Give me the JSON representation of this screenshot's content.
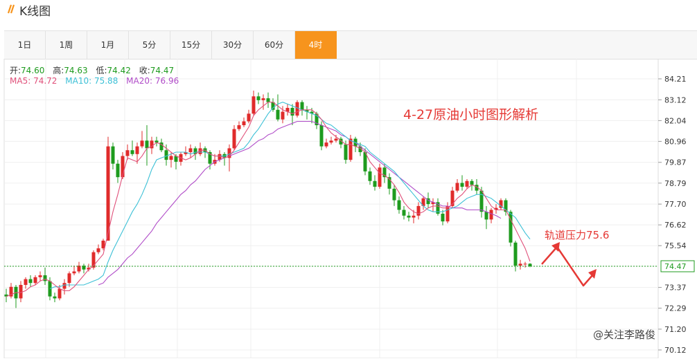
{
  "header": {
    "title": "K线图",
    "icon": "double-slash-icon"
  },
  "tabs": [
    {
      "label": "1日",
      "active": false
    },
    {
      "label": "1周",
      "active": false
    },
    {
      "label": "1月",
      "active": false
    },
    {
      "label": "5分",
      "active": false
    },
    {
      "label": "15分",
      "active": false
    },
    {
      "label": "30分",
      "active": false
    },
    {
      "label": "60分",
      "active": false
    },
    {
      "label": "4时",
      "active": true
    }
  ],
  "info": {
    "open_label": "开:",
    "open": "74.60",
    "high_label": "高:",
    "high": "74.63",
    "low_label": "低:",
    "low": "74.42",
    "close_label": "收:",
    "close": "74.47",
    "ma5_label": "MA5:",
    "ma5": "74.72",
    "ma10_label": "MA10:",
    "ma10": "75.88",
    "ma20_label": "MA20:",
    "ma20": "76.96"
  },
  "annotation": {
    "title": "4-27原油小时图形解析",
    "resistance": "轨道压力75.6"
  },
  "watermark": "@关注李路俊",
  "colors": {
    "up": "#e02b2b",
    "down": "#1e9b1e",
    "ma5": "#e0507a",
    "ma10": "#3cc0d6",
    "ma20": "#b04cc8",
    "accent": "#f7941d",
    "annotation": "#e53935"
  },
  "chart_data": {
    "type": "candlestick",
    "ylim": [
      70.12,
      84.21
    ],
    "yticks": [
      "84.21",
      "83.12",
      "82.04",
      "80.96",
      "79.87",
      "78.79",
      "77.70",
      "76.62",
      "75.54",
      "74.47",
      "73.37",
      "72.29",
      "71.20",
      "70.12"
    ],
    "last_price": "74.47",
    "candles": [
      [
        73.0,
        72.9,
        73.3,
        72.6
      ],
      [
        72.9,
        73.4,
        73.6,
        72.8
      ],
      [
        73.4,
        72.8,
        73.5,
        72.3
      ],
      [
        72.8,
        73.5,
        73.7,
        72.6
      ],
      [
        73.5,
        73.8,
        73.9,
        73.3
      ],
      [
        73.8,
        73.6,
        74.0,
        73.4
      ],
      [
        73.6,
        73.9,
        74.0,
        73.5
      ],
      [
        73.9,
        74.0,
        74.2,
        73.7
      ],
      [
        74.0,
        73.7,
        74.4,
        73.5
      ],
      [
        73.7,
        72.9,
        73.9,
        72.7
      ],
      [
        72.9,
        72.8,
        73.1,
        72.6
      ],
      [
        72.8,
        73.3,
        73.5,
        72.7
      ],
      [
        73.3,
        73.6,
        73.8,
        73.0
      ],
      [
        73.6,
        74.1,
        74.2,
        73.4
      ],
      [
        74.1,
        74.2,
        74.5,
        74.0
      ],
      [
        74.2,
        74.5,
        74.7,
        74.1
      ],
      [
        74.5,
        74.3,
        74.6,
        74.1
      ],
      [
        74.3,
        74.4,
        74.6,
        74.2
      ],
      [
        74.4,
        75.2,
        75.3,
        74.3
      ],
      [
        75.2,
        75.4,
        75.6,
        75.1
      ],
      [
        75.4,
        75.8,
        75.9,
        75.3
      ],
      [
        75.8,
        80.7,
        81.2,
        75.8
      ],
      [
        80.7,
        79.8,
        80.9,
        79.5
      ],
      [
        79.8,
        79.1,
        80.0,
        78.8
      ],
      [
        79.1,
        80.2,
        80.4,
        79.0
      ],
      [
        80.2,
        80.5,
        80.8,
        80.0
      ],
      [
        80.5,
        80.3,
        81.0,
        80.2
      ],
      [
        80.3,
        80.7,
        80.9,
        79.8
      ],
      [
        80.7,
        81.0,
        81.5,
        80.6
      ],
      [
        81.0,
        80.6,
        81.8,
        79.7
      ],
      [
        80.6,
        81.0,
        81.2,
        80.3
      ],
      [
        81.0,
        80.9,
        81.2,
        80.7
      ],
      [
        80.9,
        80.5,
        81.1,
        80.4
      ],
      [
        80.5,
        80.0,
        80.8,
        79.7
      ],
      [
        80.0,
        80.2,
        80.4,
        79.6
      ],
      [
        80.2,
        79.9,
        80.3,
        79.5
      ],
      [
        79.9,
        80.3,
        80.4,
        79.7
      ],
      [
        80.3,
        80.4,
        80.7,
        80.2
      ],
      [
        80.4,
        80.6,
        80.8,
        80.1
      ],
      [
        80.6,
        80.3,
        80.7,
        80.0
      ],
      [
        80.3,
        80.6,
        80.9,
        80.2
      ],
      [
        80.6,
        80.4,
        80.7,
        80.1
      ],
      [
        80.4,
        79.8,
        80.5,
        79.5
      ],
      [
        79.8,
        80.0,
        80.3,
        79.7
      ],
      [
        80.0,
        80.3,
        80.5,
        79.9
      ],
      [
        80.3,
        80.1,
        80.4,
        79.7
      ],
      [
        80.1,
        80.6,
        80.8,
        79.4
      ],
      [
        80.6,
        81.6,
        81.8,
        80.5
      ],
      [
        81.6,
        81.8,
        82.0,
        81.5
      ],
      [
        81.8,
        82.0,
        82.2,
        81.7
      ],
      [
        82.0,
        82.4,
        82.6,
        81.9
      ],
      [
        82.4,
        83.3,
        83.6,
        82.3
      ],
      [
        83.3,
        83.1,
        83.5,
        82.9
      ],
      [
        83.1,
        83.2,
        83.4,
        82.6
      ],
      [
        83.2,
        83.0,
        83.5,
        82.7
      ],
      [
        83.0,
        82.6,
        83.2,
        82.5
      ],
      [
        82.6,
        82.1,
        83.4,
        82.0
      ],
      [
        82.1,
        82.5,
        82.8,
        81.9
      ],
      [
        82.5,
        82.7,
        82.9,
        82.3
      ],
      [
        82.7,
        82.3,
        82.9,
        81.8
      ],
      [
        82.3,
        83.0,
        83.1,
        82.2
      ],
      [
        83.0,
        82.6,
        83.1,
        82.3
      ],
      [
        82.6,
        82.5,
        82.8,
        82.1
      ],
      [
        82.5,
        82.4,
        82.7,
        81.9
      ],
      [
        82.4,
        81.8,
        82.5,
        81.6
      ],
      [
        81.8,
        80.7,
        82.0,
        80.5
      ],
      [
        80.7,
        80.9,
        81.1,
        80.6
      ],
      [
        80.9,
        81.0,
        81.2,
        80.8
      ],
      [
        81.0,
        81.1,
        81.3,
        80.9
      ],
      [
        81.1,
        80.8,
        81.2,
        80.6
      ],
      [
        80.8,
        80.0,
        81.0,
        79.8
      ],
      [
        80.0,
        81.1,
        81.3,
        79.9
      ],
      [
        81.1,
        80.7,
        81.2,
        80.4
      ],
      [
        80.7,
        80.4,
        80.9,
        80.2
      ],
      [
        80.4,
        79.4,
        80.6,
        79.2
      ],
      [
        79.4,
        78.9,
        79.6,
        78.7
      ],
      [
        78.9,
        78.6,
        79.2,
        78.4
      ],
      [
        78.6,
        79.6,
        79.8,
        78.5
      ],
      [
        79.6,
        79.1,
        79.8,
        78.8
      ],
      [
        79.1,
        78.5,
        79.3,
        78.2
      ],
      [
        78.5,
        77.9,
        78.7,
        77.6
      ],
      [
        77.9,
        77.4,
        78.1,
        77.2
      ],
      [
        77.4,
        77.1,
        77.6,
        76.9
      ],
      [
        77.1,
        77.0,
        77.3,
        76.8
      ],
      [
        77.0,
        77.1,
        77.4,
        76.7
      ],
      [
        77.1,
        77.6,
        77.8,
        76.9
      ],
      [
        77.6,
        78.0,
        78.1,
        77.4
      ],
      [
        78.0,
        77.7,
        78.3,
        77.5
      ],
      [
        77.7,
        77.8,
        78.0,
        77.3
      ],
      [
        77.8,
        77.2,
        78.0,
        77.1
      ],
      [
        77.2,
        76.8,
        77.4,
        76.6
      ],
      [
        76.8,
        77.6,
        77.8,
        76.7
      ],
      [
        77.6,
        78.4,
        78.6,
        77.5
      ],
      [
        78.4,
        78.8,
        79.0,
        78.3
      ],
      [
        78.8,
        78.6,
        79.2,
        78.4
      ],
      [
        78.6,
        78.9,
        79.0,
        78.5
      ],
      [
        78.9,
        78.7,
        79.0,
        78.4
      ],
      [
        78.7,
        78.4,
        79.0,
        78.2
      ],
      [
        78.4,
        77.3,
        78.6,
        77.0
      ],
      [
        77.3,
        76.9,
        77.6,
        76.4
      ],
      [
        76.9,
        77.4,
        77.5,
        76.7
      ],
      [
        77.4,
        77.5,
        77.7,
        77.2
      ],
      [
        77.5,
        77.9,
        78.0,
        77.4
      ],
      [
        77.9,
        77.3,
        78.0,
        77.1
      ],
      [
        77.3,
        75.7,
        77.4,
        75.5
      ],
      [
        75.7,
        74.5,
        75.8,
        74.2
      ],
      [
        74.5,
        74.6,
        74.8,
        74.3
      ],
      [
        74.6,
        74.6,
        74.7,
        74.4
      ],
      [
        74.6,
        74.47,
        74.63,
        74.42
      ]
    ],
    "ma5": [
      72.9,
      73.0,
      73.1,
      73.1,
      73.2,
      73.4,
      73.5,
      73.7,
      73.8,
      73.7,
      73.5,
      73.3,
      73.2,
      73.2,
      73.4,
      73.7,
      74.0,
      74.3,
      74.5,
      74.8,
      75.1,
      76.2,
      77.3,
      78.2,
      79.2,
      80.1,
      80.0,
      79.9,
      80.2,
      80.6,
      80.7,
      80.9,
      80.8,
      80.6,
      80.4,
      80.2,
      80.1,
      80.0,
      80.1,
      80.3,
      80.5,
      80.5,
      80.3,
      80.2,
      80.2,
      80.1,
      80.2,
      80.5,
      80.9,
      81.3,
      81.7,
      82.3,
      82.6,
      82.8,
      83.0,
      83.0,
      82.8,
      82.6,
      82.5,
      82.4,
      82.5,
      82.6,
      82.6,
      82.6,
      82.4,
      82.1,
      81.7,
      81.4,
      81.2,
      81.0,
      80.8,
      80.8,
      80.7,
      80.6,
      80.4,
      79.9,
      79.6,
      79.3,
      79.2,
      79.0,
      78.7,
      78.3,
      77.8,
      77.5,
      77.3,
      77.2,
      77.3,
      77.5,
      77.6,
      77.6,
      77.5,
      77.5,
      77.7,
      78.0,
      78.2,
      78.5,
      78.7,
      78.6,
      78.4,
      78.0,
      77.6,
      77.4,
      77.4,
      77.4,
      76.9,
      76.4,
      75.9,
      75.4,
      74.72
    ],
    "ma10": [
      null,
      null,
      null,
      null,
      null,
      null,
      null,
      null,
      null,
      73.3,
      73.4,
      73.4,
      73.5,
      73.5,
      73.5,
      73.5,
      73.5,
      73.6,
      73.7,
      73.8,
      74.0,
      74.7,
      75.3,
      75.8,
      76.3,
      76.8,
      77.3,
      77.7,
      78.2,
      78.8,
      79.5,
      80.0,
      80.1,
      80.2,
      80.3,
      80.4,
      80.4,
      80.4,
      80.3,
      80.4,
      80.4,
      80.4,
      80.3,
      80.2,
      80.2,
      80.2,
      80.3,
      80.4,
      80.5,
      80.6,
      80.9,
      81.3,
      81.6,
      82.0,
      82.4,
      82.7,
      82.9,
      83.0,
      82.9,
      82.8,
      82.7,
      82.6,
      82.5,
      82.4,
      82.3,
      82.1,
      81.9,
      81.8,
      81.6,
      81.4,
      81.2,
      81.0,
      80.9,
      80.8,
      80.7,
      80.4,
      80.2,
      80.0,
      79.8,
      79.6,
      79.4,
      79.1,
      78.8,
      78.5,
      78.2,
      77.9,
      77.6,
      77.4,
      77.3,
      77.3,
      77.3,
      77.4,
      77.5,
      77.6,
      77.8,
      78.0,
      78.1,
      78.2,
      78.2,
      78.1,
      78.0,
      77.8,
      77.6,
      77.4,
      77.2,
      77.0,
      76.6,
      76.2,
      75.88
    ],
    "ma20": [
      null,
      null,
      null,
      null,
      null,
      null,
      null,
      null,
      null,
      null,
      null,
      null,
      null,
      null,
      null,
      null,
      null,
      null,
      null,
      73.5,
      73.6,
      73.9,
      74.1,
      74.3,
      74.6,
      74.9,
      75.1,
      75.4,
      75.7,
      76.0,
      76.3,
      76.7,
      77.0,
      77.3,
      77.6,
      77.9,
      78.2,
      78.4,
      78.7,
      78.9,
      79.2,
      79.5,
      79.7,
      79.9,
      80.0,
      80.1,
      80.2,
      80.3,
      80.4,
      80.5,
      80.6,
      80.8,
      81.0,
      81.1,
      81.3,
      81.4,
      81.6,
      81.7,
      81.8,
      81.9,
      82.0,
      82.0,
      82.0,
      82.0,
      81.9,
      81.8,
      81.7,
      81.6,
      81.5,
      81.3,
      81.2,
      81.0,
      80.9,
      80.7,
      80.5,
      80.3,
      80.1,
      79.9,
      79.7,
      79.5,
      79.3,
      79.1,
      78.9,
      78.7,
      78.5,
      78.3,
      78.1,
      77.9,
      77.8,
      77.7,
      77.6,
      77.6,
      77.5,
      77.5,
      77.5,
      77.4,
      77.4,
      77.4,
      77.4,
      77.3,
      77.2,
      77.1,
      76.96
    ]
  }
}
